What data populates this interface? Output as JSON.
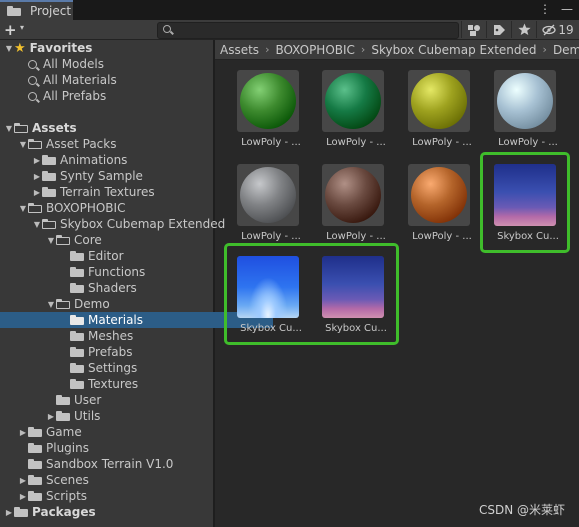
{
  "window": {
    "tab_label": "Project",
    "tab_icon": "folder-icon",
    "more_glyph": "⋮",
    "min_glyph": "—"
  },
  "toolbar": {
    "add_label": "+",
    "add_caret": "▾",
    "search_placeholder": "",
    "hidden_count": "19",
    "icons": [
      "create-icon",
      "search-icon",
      "search-by-type-icon",
      "label-icon",
      "favorite-star-icon",
      "hidden-packages-icon"
    ]
  },
  "sidebar": {
    "rows": [
      {
        "label": "Favorites",
        "arrow": "▼",
        "icon": "star",
        "bold": true
      },
      {
        "label": "All Models",
        "icon": "magnifier"
      },
      {
        "label": "All Materials",
        "icon": "magnifier"
      },
      {
        "label": "All Prefabs",
        "icon": "magnifier"
      },
      {
        "label": "",
        "icon": "none"
      },
      {
        "label": "Assets",
        "arrow": "▼",
        "icon": "folder-open",
        "bold": true
      },
      {
        "label": "Asset Packs",
        "arrow": "▼",
        "icon": "folder-open"
      },
      {
        "label": "Animations",
        "arrow": "▶",
        "icon": "folder"
      },
      {
        "label": "Synty Sample",
        "arrow": "▶",
        "icon": "folder"
      },
      {
        "label": "Terrain Textures",
        "arrow": "▶",
        "icon": "folder"
      },
      {
        "label": "BOXOPHOBIC",
        "arrow": "▼",
        "icon": "folder-open"
      },
      {
        "label": "Skybox Cubemap Extended",
        "arrow": "▼",
        "icon": "folder-open"
      },
      {
        "label": "Core",
        "arrow": "▼",
        "icon": "folder-open"
      },
      {
        "label": "Editor",
        "icon": "folder"
      },
      {
        "label": "Functions",
        "icon": "folder"
      },
      {
        "label": "Shaders",
        "icon": "folder"
      },
      {
        "label": "Demo",
        "arrow": "▼",
        "icon": "folder-open"
      },
      {
        "label": "Materials",
        "icon": "folder",
        "selected": true
      },
      {
        "label": "Meshes",
        "icon": "folder"
      },
      {
        "label": "Prefabs",
        "icon": "folder"
      },
      {
        "label": "Settings",
        "icon": "folder"
      },
      {
        "label": "Textures",
        "icon": "folder"
      },
      {
        "label": "User",
        "icon": "folder"
      },
      {
        "label": "Utils",
        "arrow": "▶",
        "icon": "folder"
      },
      {
        "label": "Game",
        "arrow": "▶",
        "icon": "folder"
      },
      {
        "label": "Plugins",
        "icon": "folder"
      },
      {
        "label": "Sandbox Terrain V1.0",
        "icon": "folder"
      },
      {
        "label": "Scenes",
        "arrow": "▶",
        "icon": "folder"
      },
      {
        "label": "Scripts",
        "arrow": "▶",
        "icon": "folder"
      },
      {
        "label": "Packages",
        "arrow": "▶",
        "icon": "folder",
        "bold": true
      }
    ]
  },
  "breadcrumb": {
    "items": [
      "Assets",
      "BOXOPHOBIC",
      "Skybox Cubemap Extended",
      "Demo"
    ],
    "separator": "›"
  },
  "assets": [
    {
      "label": "LowPoly - ...",
      "kind": "sphere",
      "color": "#3d8a2e"
    },
    {
      "label": "LowPoly - ...",
      "kind": "sphere",
      "color": "#157a45"
    },
    {
      "label": "LowPoly - ...",
      "kind": "sphere",
      "color": "#9ea21f"
    },
    {
      "label": "LowPoly - ...",
      "kind": "sphere",
      "color": "#a7c1d3"
    },
    {
      "label": "LowPoly - ...",
      "kind": "sphere",
      "color": "#808285"
    },
    {
      "label": "LowPoly - ...",
      "kind": "sphere",
      "color": "#6a4a40"
    },
    {
      "label": "LowPoly - ...",
      "kind": "sphere",
      "color": "#b4642a"
    },
    {
      "label": "Skybox Cu...",
      "kind": "sky-dusk",
      "color": "#3a4fa8",
      "highlighted": true
    },
    {
      "label": "Skybox Cu...",
      "kind": "sky-day",
      "color": "#2f6fe0",
      "highlighted": true
    },
    {
      "label": "Skybox Cu...",
      "kind": "sky-dusk",
      "color": "#3a4fa8",
      "highlighted": true
    }
  ],
  "highlight_color": "#3fbd2b",
  "watermark": "CSDN @米莱虾"
}
